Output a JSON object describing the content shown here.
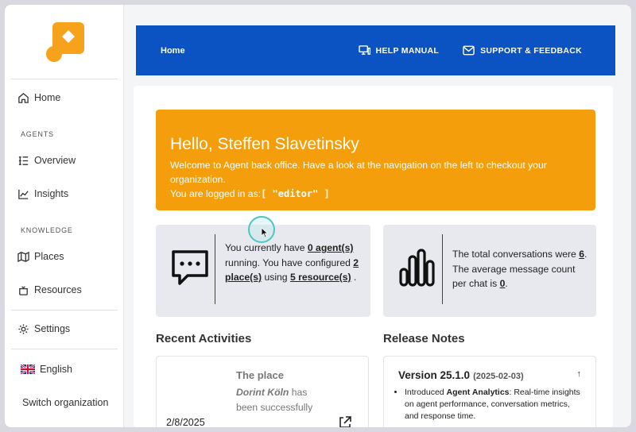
{
  "sidebar": {
    "home": "Home",
    "agents_section": "AGENTS",
    "overview": "Overview",
    "insights": "Insights",
    "knowledge_section": "KNOWLEDGE",
    "places": "Places",
    "resources": "Resources",
    "settings": "Settings",
    "language": "English",
    "switch_org": "Switch organization"
  },
  "topbar": {
    "home": "Home",
    "help_manual": "HELP MANUAL",
    "support": "SUPPORT & FEEDBACK"
  },
  "hero": {
    "greeting": "Hello, Steffen Slavetinsky",
    "welcome": "Welcome to Agent back office. Have a look at the navigation on the left to checkout your organization.",
    "logged_in_prefix": "You are logged in as:",
    "role": "[ \"editor\" ]"
  },
  "stats": {
    "agents": {
      "t1": "You currently have ",
      "agents_link": "0 agent(s)",
      "t2": " running. You have configured ",
      "places_link": "2 place(s)",
      "t3": " using ",
      "resources_link": "5 resource(s)",
      "t4": " ."
    },
    "conversations": {
      "t1": "The total conversations were ",
      "total": "6",
      "t2": ". The average message count per chat is ",
      "avg": "0",
      "t3": "."
    }
  },
  "recent": {
    "title": "Recent Activities",
    "item_title": "The place",
    "item_place": "Dorint Köln",
    "item_rest": " has been successfully",
    "item_date": "2/8/2025"
  },
  "release": {
    "title": "Release Notes",
    "version": "Version 25.1.0",
    "date": "(2025-02-03)",
    "toggle": "↑",
    "note_prefix": "Introduced ",
    "note_bold": "Agent Analytics",
    "note_rest": ": Real-time insights on agent performance, conversation metrics, and response time."
  },
  "colors": {
    "brand_blue": "#0b52c2",
    "hero_orange": "#f59e0b",
    "logo_orange": "#f7a21b"
  }
}
